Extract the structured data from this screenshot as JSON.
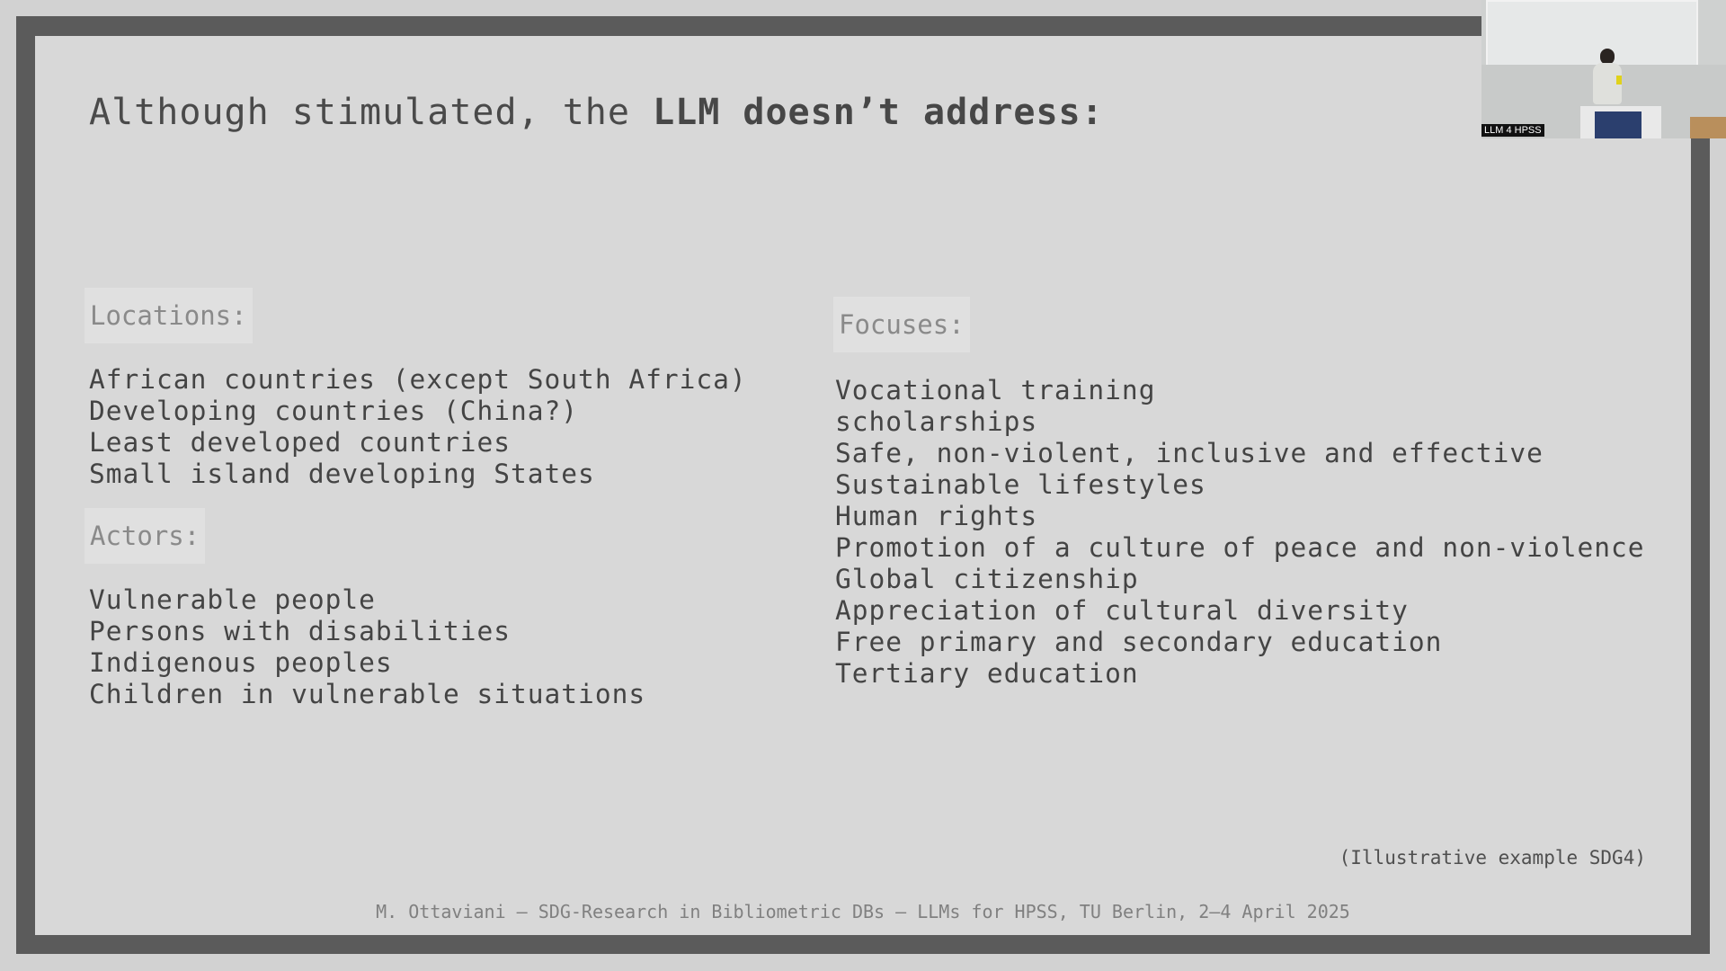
{
  "slide": {
    "title_prefix": "Although stimulated, the ",
    "title_bold": "LLM doesn’t address:",
    "locations": {
      "label": "Locations:",
      "items": [
        "African countries (except South Africa)",
        "Developing countries (China?)",
        "Least developed countries",
        "Small island developing States"
      ]
    },
    "actors": {
      "label": "Actors:",
      "items": [
        "Vulnerable people",
        "Persons with disabilities",
        "Indigenous peoples",
        "Children in vulnerable situations"
      ]
    },
    "focuses": {
      "label": "Focuses:",
      "items": [
        "Vocational training",
        "scholarships",
        "Safe, non-violent, inclusive and effective",
        "Sustainable lifestyles",
        "Human rights",
        "Promotion of a culture of peace and non-violence",
        "Global citizenship",
        "Appreciation of cultural diversity",
        "Free primary and secondary education",
        "Tertiary education"
      ]
    },
    "note": "(Illustrative example SDG4)",
    "footer": "M. Ottaviani – SDG-Research in Bibliometric DBs – LLMs for HPSS, TU Berlin, 2–4 April 2025"
  },
  "camera": {
    "label": "LLM 4 HPSS"
  },
  "colors": {
    "frame": "#5b5b5b",
    "slide_background": "#d8d8d8",
    "label_background": "#e0e0e0",
    "text": "#444444"
  }
}
